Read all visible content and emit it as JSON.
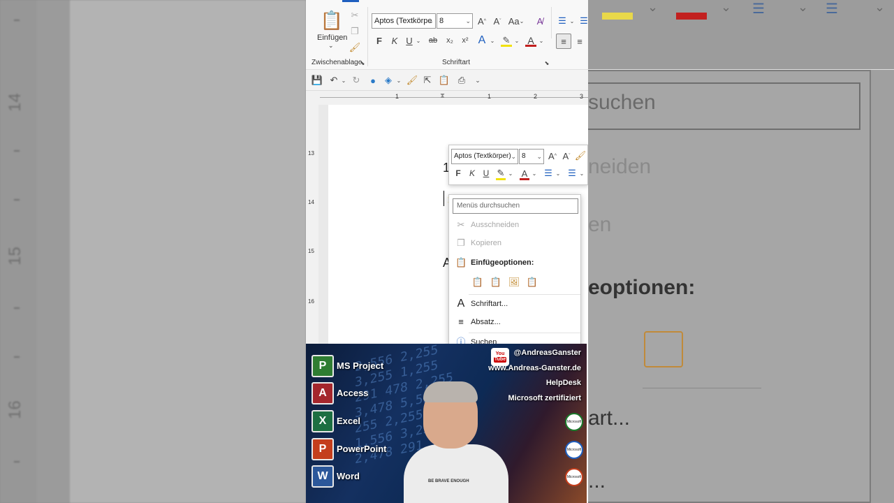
{
  "background_left": {
    "ruler_numbers": [
      "14",
      "15",
      "16"
    ]
  },
  "background_right": {
    "texts": [
      "suchen",
      "neiden",
      "en",
      "eoptionen:",
      "art...",
      "..."
    ]
  },
  "ribbon": {
    "paste_label": "Einfügen",
    "clipboard_group": "Zwischenablage",
    "font_group": "Schriftart",
    "font_name": "Aptos (Textkörpe",
    "font_size": "8",
    "bold": "F",
    "italic": "K",
    "underline": "U",
    "strike": "ab",
    "subscript": "x₂",
    "superscript": "x²",
    "case": "Aa"
  },
  "ruler": {
    "h_ticks": [
      "1",
      "1",
      "2",
      "3"
    ],
    "v_ticks": [
      "13",
      "14",
      "15",
      "16"
    ]
  },
  "document": {
    "line1": "1",
    "line2": "A"
  },
  "mini_toolbar": {
    "font_name": "Aptos (Textkörper)",
    "font_size": "8",
    "bold": "F",
    "italic": "K",
    "underline": "U"
  },
  "context_menu": {
    "search_placeholder": "Menüs durchsuchen",
    "cut": "Ausschneiden",
    "copy": "Kopieren",
    "paste_options": "Einfügeoptionen:",
    "font": "Schriftart...",
    "paragraph": "Absatz...",
    "search": "Suchen"
  },
  "overlay": {
    "apps": [
      {
        "name": "MS Project",
        "letter": "P",
        "color": "#2f7d32"
      },
      {
        "name": "Access",
        "letter": "A",
        "color": "#a4262c"
      },
      {
        "name": "Excel",
        "letter": "X",
        "color": "#1d6f42"
      },
      {
        "name": "PowerPoint",
        "letter": "P",
        "color": "#c43e1c"
      },
      {
        "name": "Word",
        "letter": "W",
        "color": "#2b579a"
      }
    ],
    "youtube_top": "You",
    "youtube_bottom": "Tube",
    "handle": "@AndreasGanster",
    "website": "www.Andreas-Ganster.de",
    "helpdesk": "HelpDesk",
    "certified": "Microsoft zertifiziert",
    "badge_text": "Microsoft",
    "shirt_text": "BE BRAVE ENOUGH"
  }
}
